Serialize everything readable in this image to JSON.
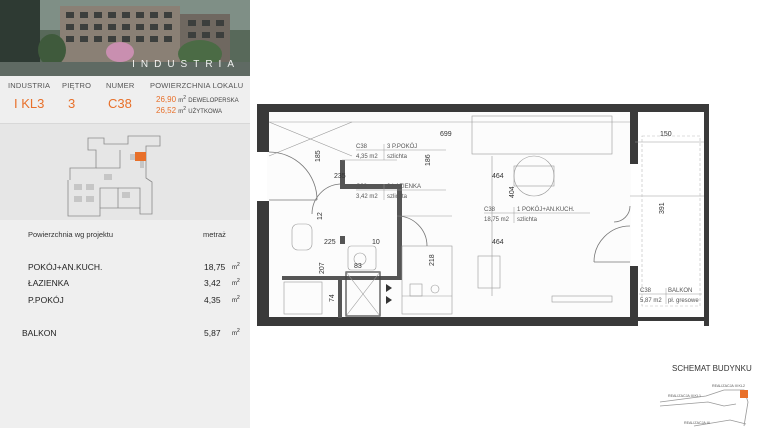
{
  "hero": {
    "brand": "INDUSTRIA"
  },
  "info": {
    "headers": [
      "INDUSTRIA",
      "PIĘTRO",
      "NUMER",
      "POWIERZCHNIA LOKALU"
    ],
    "building": "I KL3",
    "floor": "3",
    "number": "C38",
    "area_dev": "26,90",
    "area_dev_label": "DEWELOPERSKA",
    "area_use": "26,52",
    "area_use_label": "UŻYTKOWA",
    "unit": "m"
  },
  "table": {
    "title": "Powierzchnia wg projektu",
    "col": "metraż",
    "rows": [
      {
        "name": "POKÓJ+AN.KUCH.",
        "value": "18,75",
        "unit": "m"
      },
      {
        "name": "ŁAZIENKA",
        "value": "3,42",
        "unit": "m"
      },
      {
        "name": "P.POKÓJ",
        "value": "4,35",
        "unit": "m"
      }
    ],
    "balcony": {
      "name": "BALKON",
      "value": "5,87",
      "unit": "m"
    }
  },
  "plan": {
    "dims": {
      "d699": "699",
      "d150": "150",
      "d185": "185",
      "d186": "186",
      "d235": "235",
      "d464a": "464",
      "d404": "404",
      "d391": "391",
      "d12": "12",
      "d225": "225",
      "d10": "10",
      "d464b": "464",
      "d207": "207",
      "d218": "218",
      "d83": "83",
      "d74": "74"
    },
    "rooms": [
      {
        "code": "C38",
        "name": "3 P.POKÓJ",
        "area": "4,35 m2",
        "floor": "szlichta"
      },
      {
        "code": "C38",
        "name": "2 ŁAZIENKA",
        "area": "3,42 m2",
        "floor": "szlichta"
      },
      {
        "code": "C38",
        "name": "1 POKÓJ+AN.KUCH.",
        "area": "18,75 m2",
        "floor": "szlichta"
      },
      {
        "code": "C38",
        "name": "BALKON",
        "area": "5,87 m2",
        "floor": "pł. gresowe"
      }
    ]
  },
  "schemat": {
    "title": "SCHEMAT BUDYNKU",
    "labels": [
      "REALIZACJA III KL2",
      "REALIZACJA III KL1",
      "REALIZACJA III"
    ]
  },
  "colors": {
    "accent": "#e8702a",
    "wall": "#3a3a3a"
  }
}
